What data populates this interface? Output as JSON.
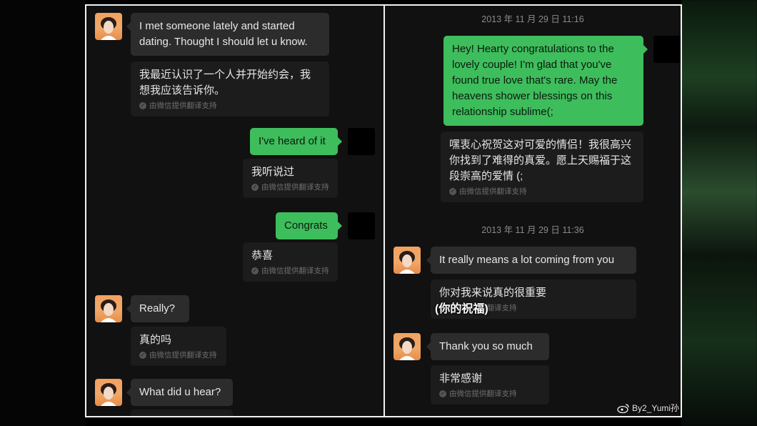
{
  "translation_note": "由微信提供翻译支持",
  "left_chat": {
    "messages": [
      {
        "text": "I met someone lately and started dating.  Thought I should let u know.",
        "translation": "我最近认识了一个人并开始约会，我想我应该告诉你。"
      },
      {
        "text": "I've heard of it",
        "translation": "我听说过"
      },
      {
        "text": "Congrats",
        "translation": "恭喜"
      },
      {
        "text": "Really?",
        "translation": "真的吗"
      },
      {
        "text": "What did u hear?"
      }
    ]
  },
  "right_chat": {
    "timestamp_1": "2013 年 11 月 29 日  11:16",
    "timestamp_2": "2013 年 11 月 29 日  11:36",
    "messages": [
      {
        "text": "Hey! Hearty congratulations to the lovely couple! I'm glad that you've found true love that's rare. May the heavens shower blessings on this relationship sublime(;",
        "translation": "嘿衷心祝贺这对可爱的情侣！我很高兴你找到了难得的真爱。愿上天赐福于这段崇高的爱情 (;"
      },
      {
        "text": "It really means a lot coming from you",
        "translation": "你对我来说真的很重要"
      },
      {
        "text": "Thank you so much",
        "translation": "非常感谢"
      }
    ],
    "overlay_caption": "(你的祝福)"
  },
  "watermark": "By2_Yumi孙",
  "icons": {
    "avatar": "avatar-photo",
    "check": "check-circle-icon",
    "weibo": "weibo-logo-icon"
  },
  "colors": {
    "green_bubble": "#3ebd5c",
    "gray_bubble": "#2c2c2c",
    "background": "#111111"
  }
}
